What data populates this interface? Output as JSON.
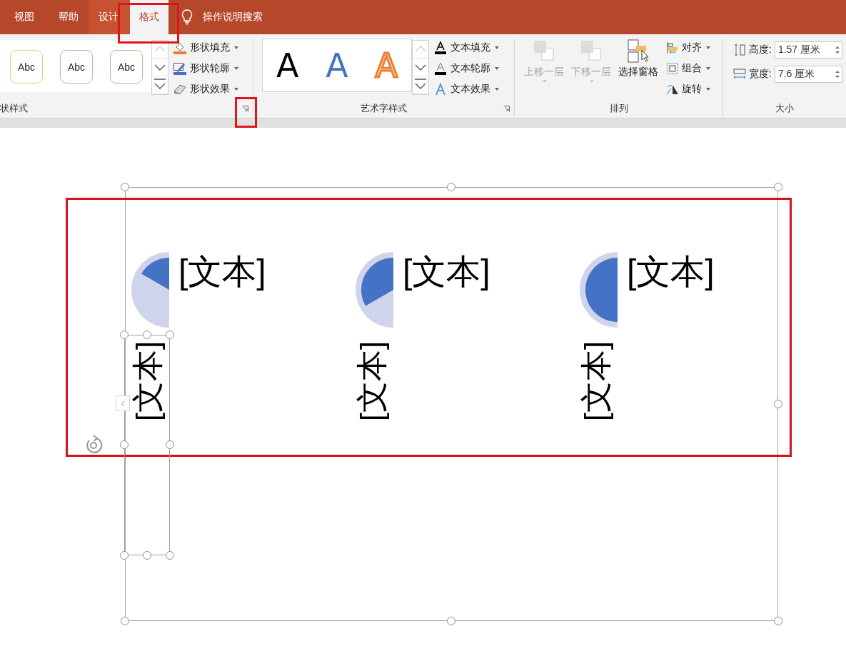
{
  "tabs": [
    {
      "label": "视图",
      "selected": false
    },
    {
      "label": "帮助",
      "selected": false
    },
    {
      "label": "设计",
      "selected": false
    },
    {
      "label": "格式",
      "selected": true
    }
  ],
  "tell_me": {
    "label": "操作说明搜索"
  },
  "shape_styles": {
    "label": "状样式",
    "presets": [
      {
        "text": "Abc",
        "color": "#f0d070"
      },
      {
        "text": "Abc",
        "color": "#9db8d8"
      },
      {
        "text": "Abc",
        "color": "#a9c08f"
      }
    ],
    "commands": [
      "形状填充",
      "形状轮廓",
      "形状效果"
    ]
  },
  "wordart_styles": {
    "label": "艺术字样式",
    "presets": [
      {
        "text": "A",
        "kind": "fill",
        "color": "#000000"
      },
      {
        "text": "A",
        "kind": "fill",
        "color": "#4472c4"
      },
      {
        "text": "A",
        "kind": "outline",
        "color": "#ed7d31"
      }
    ],
    "commands": [
      "文本填充",
      "文本轮廓",
      "文本效果"
    ]
  },
  "arrange": {
    "label": "排列",
    "buttons": [
      {
        "label": "上移一层",
        "disabled": true
      },
      {
        "label": "下移一层",
        "disabled": true
      },
      {
        "label": "选择窗格",
        "disabled": false
      }
    ],
    "commands": [
      "对齐",
      "组合",
      "旋转"
    ]
  },
  "size": {
    "label": "大小",
    "fields": [
      {
        "label": "高度:",
        "value": "1.57 厘米"
      },
      {
        "label": "宽度:",
        "value": "7.6 厘米"
      }
    ]
  },
  "slide": {
    "items": [
      {
        "title": "[文本]",
        "caption": "[文本]",
        "selected": true
      },
      {
        "title": "[文本]",
        "caption": "[文本]",
        "selected": false
      },
      {
        "title": "[文本]",
        "caption": "[文本]",
        "selected": false
      }
    ]
  }
}
